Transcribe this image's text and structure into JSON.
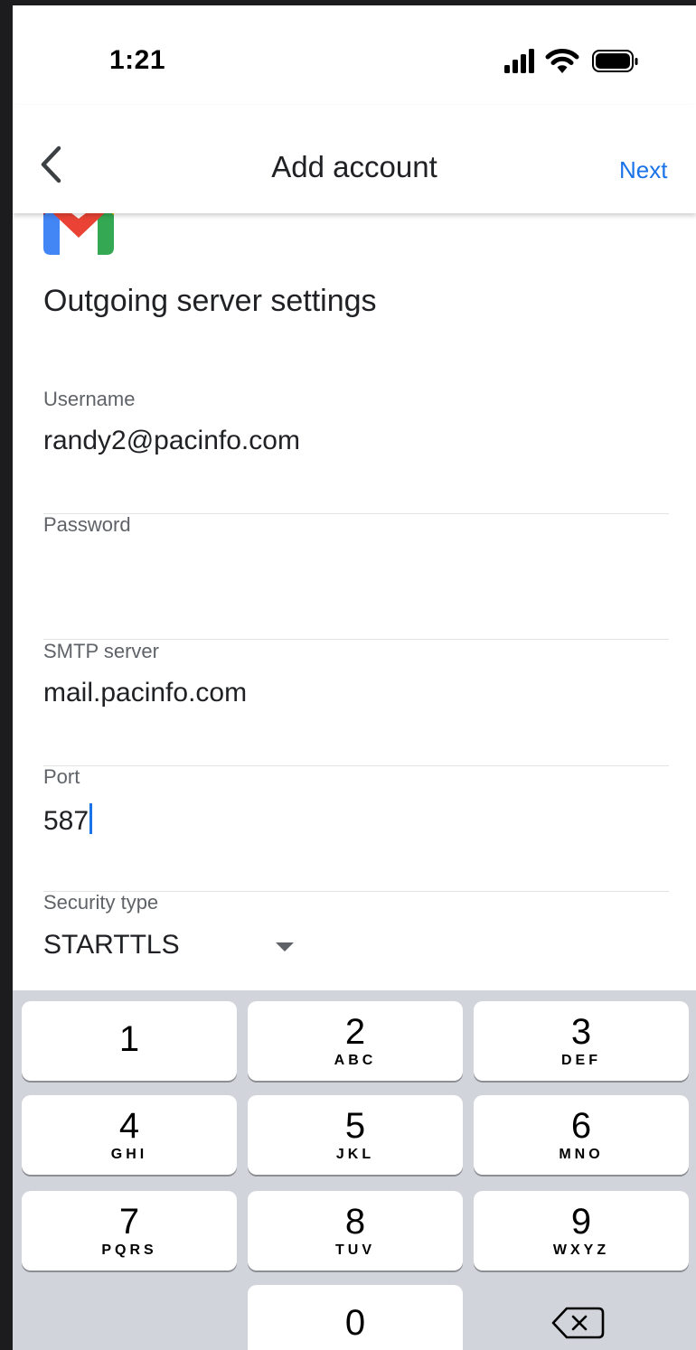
{
  "status_bar": {
    "time": "1:21",
    "icons": [
      "signal-icon",
      "wifi-icon",
      "battery-icon"
    ]
  },
  "app_bar": {
    "back_icon": "chevron-left-icon",
    "title": "Add account",
    "next_label": "Next"
  },
  "form": {
    "section_title": "Outgoing server settings",
    "username": {
      "label": "Username",
      "value": "randy2@pacinfo.com"
    },
    "password": {
      "label": "Password",
      "value": ""
    },
    "smtp_server": {
      "label": "SMTP server",
      "value": "mail.pacinfo.com"
    },
    "port": {
      "label": "Port",
      "value": "587"
    },
    "security_type": {
      "label": "Security type",
      "value": "STARTTLS"
    }
  },
  "keyboard": {
    "keys": [
      {
        "digit": "1",
        "letters": ""
      },
      {
        "digit": "2",
        "letters": "ABC"
      },
      {
        "digit": "3",
        "letters": "DEF"
      },
      {
        "digit": "4",
        "letters": "GHI"
      },
      {
        "digit": "5",
        "letters": "JKL"
      },
      {
        "digit": "6",
        "letters": "MNO"
      },
      {
        "digit": "7",
        "letters": "PQRS"
      },
      {
        "digit": "8",
        "letters": "TUV"
      },
      {
        "digit": "9",
        "letters": "WXYZ"
      },
      {
        "digit": "0",
        "letters": ""
      }
    ],
    "delete_icon": "backspace-icon"
  },
  "colors": {
    "accent": "#1a73e8",
    "keyboard_bg": "#d1d4da",
    "text_primary": "#202124",
    "text_secondary": "#5f6368"
  }
}
